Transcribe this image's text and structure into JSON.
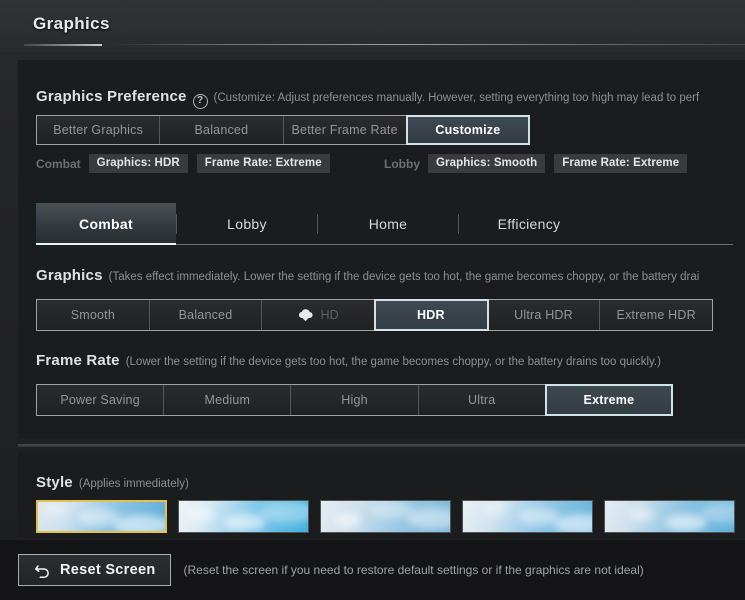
{
  "header": {
    "title": "Graphics"
  },
  "graphics_preference": {
    "label": "Graphics Preference",
    "help_icon": "help-circle-icon",
    "description": "(Customize: Adjust preferences manually. However, setting everything too high may lead to perf",
    "options": [
      {
        "label": "Better Graphics",
        "selected": false
      },
      {
        "label": "Balanced",
        "selected": false
      },
      {
        "label": "Better Frame Rate",
        "selected": false
      },
      {
        "label": "Customize",
        "selected": true
      }
    ],
    "badge_groups": [
      {
        "group": "Combat",
        "badges": [
          "Graphics: HDR",
          "Frame Rate: Extreme"
        ]
      },
      {
        "group": "Lobby",
        "badges": [
          "Graphics: Smooth",
          "Frame Rate: Extreme"
        ]
      }
    ]
  },
  "tabs": [
    {
      "label": "Combat",
      "selected": true
    },
    {
      "label": "Lobby",
      "selected": false
    },
    {
      "label": "Home",
      "selected": false
    },
    {
      "label": "Efficiency",
      "selected": false
    }
  ],
  "graphics": {
    "label": "Graphics",
    "description": "(Takes effect immediately. Lower the setting if the device gets too hot, the game becomes choppy, or the battery drai",
    "options": [
      {
        "label": "Smooth",
        "selected": false,
        "icon": null,
        "disabled": false
      },
      {
        "label": "Balanced",
        "selected": false,
        "icon": null,
        "disabled": false
      },
      {
        "label": "HD",
        "selected": false,
        "icon": "cloud-download-icon",
        "disabled": true
      },
      {
        "label": "HDR",
        "selected": true,
        "icon": null,
        "disabled": false
      },
      {
        "label": "Ultra HDR",
        "selected": false,
        "icon": null,
        "disabled": false
      },
      {
        "label": "Extreme HDR",
        "selected": false,
        "icon": null,
        "disabled": false
      }
    ]
  },
  "frame_rate": {
    "label": "Frame Rate",
    "description": "(Lower the setting if the device gets too hot, the game becomes choppy, or the battery drains too quickly.)",
    "options": [
      {
        "label": "Power Saving",
        "selected": false
      },
      {
        "label": "Medium",
        "selected": false
      },
      {
        "label": "High",
        "selected": false
      },
      {
        "label": "Ultra",
        "selected": false
      },
      {
        "label": "Extreme",
        "selected": true
      }
    ]
  },
  "style": {
    "label": "Style",
    "description": "(Applies immediately)",
    "thumbnails": [
      {
        "name": "style-thumb-1",
        "selected": true
      },
      {
        "name": "style-thumb-2",
        "selected": false
      },
      {
        "name": "style-thumb-3",
        "selected": false
      },
      {
        "name": "style-thumb-4",
        "selected": false
      },
      {
        "name": "style-thumb-5",
        "selected": false
      }
    ]
  },
  "reset": {
    "icon": "undo-arrow-icon",
    "label": "Reset Screen",
    "description": "(Reset the screen if you need to restore default settings or if the graphics are not ideal)"
  },
  "colors": {
    "selected_border": "#cfe4e6",
    "selected_fill": "#3f4950",
    "thumb_selected_border": "#e3c14a",
    "panel_bg": "#1b1c1e",
    "text_primary": "#e8eaec",
    "text_muted": "#8d9094"
  }
}
